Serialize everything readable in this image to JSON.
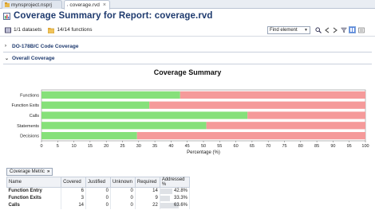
{
  "tabs": [
    {
      "label": "mynsproject.nsprj",
      "active": false,
      "icon": "project-icon"
    },
    {
      "label": "coverage.rvd",
      "active": true,
      "icon": "report-icon"
    }
  ],
  "title": "Coverage Summary for Report: coverage.rvd",
  "toolbar": {
    "datasets": "1/1 datasets",
    "functions": "14/14 functions",
    "find_placeholder": "Find element"
  },
  "sections": {
    "code_coverage": "DO-178B/C Code Coverage",
    "overall": "Overall Coverage"
  },
  "chart_data": {
    "type": "bar",
    "orientation": "horizontal",
    "stacked": true,
    "title": "Coverage Summary",
    "xlabel": "Percentage (%)",
    "xlim": [
      0,
      100
    ],
    "xticks": [
      0,
      5,
      10,
      15,
      20,
      25,
      30,
      35,
      40,
      45,
      50,
      55,
      60,
      65,
      70,
      75,
      80,
      85,
      90,
      95,
      100
    ],
    "categories": [
      "Functions",
      "Function Exits",
      "Calls",
      "Statements",
      "Decisions"
    ],
    "series": [
      {
        "color": "#86e07a",
        "values": [
          42.8,
          33.3,
          63.6,
          50.9,
          29.5
        ]
      },
      {
        "color": "#f59a9a",
        "values": [
          57.2,
          66.7,
          36.4,
          49.1,
          70.5
        ]
      }
    ]
  },
  "metric_button": "Coverage Metric",
  "table": {
    "headers": [
      "Name",
      "Covered",
      "Justified",
      "Unknown",
      "Required",
      "Addressed %"
    ],
    "rows": [
      {
        "name": "Function Entry",
        "covered": "6",
        "justified": "0",
        "unknown": "0",
        "required": "14",
        "addressed": "42.8%",
        "fraction": 0.428
      },
      {
        "name": "Function Exits",
        "covered": "3",
        "justified": "0",
        "unknown": "0",
        "required": "9",
        "addressed": "33.3%",
        "fraction": 0.333
      },
      {
        "name": "Calls",
        "covered": "14",
        "justified": "0",
        "unknown": "0",
        "required": "22",
        "addressed": "63.6%",
        "fraction": 0.636
      }
    ]
  }
}
